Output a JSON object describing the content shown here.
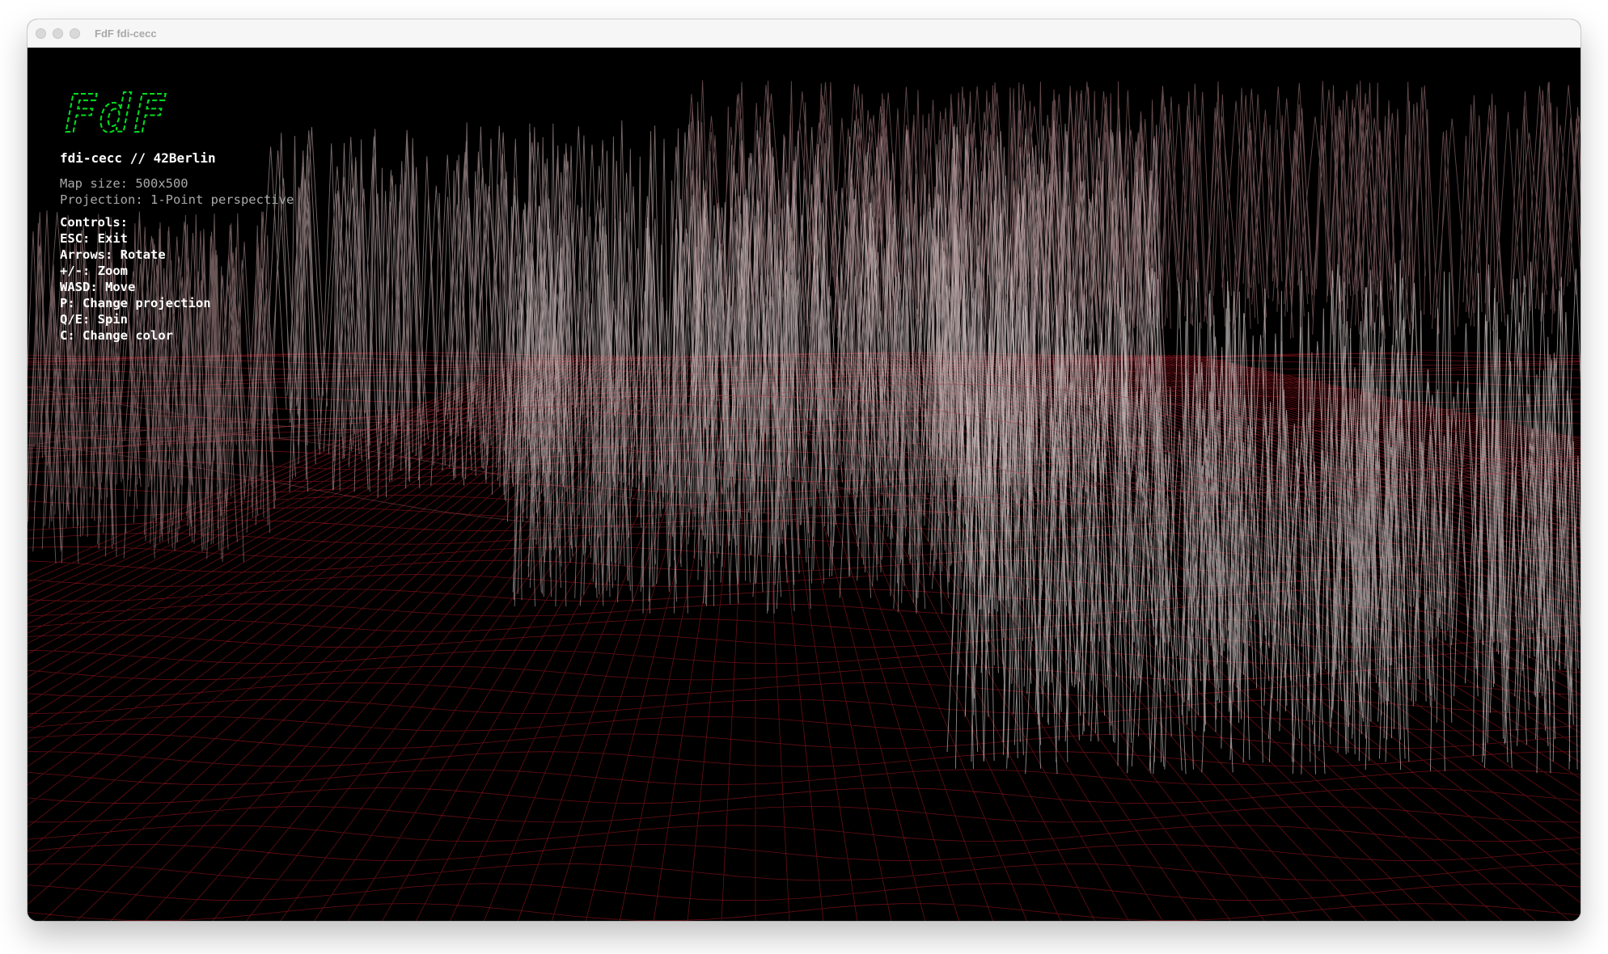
{
  "window": {
    "title": "FdF fdi-cecc"
  },
  "logo": {
    "text": "FdF",
    "color": "#00e020"
  },
  "hud": {
    "title": "fdi-cecc // 42Berlin",
    "map_size": "Map size: 500x500",
    "projection": "Projection: 1-Point perspective",
    "controls_header": "Controls:",
    "controls": [
      "ESC: Exit",
      "Arrows: Rotate",
      "+/-: Zoom",
      "WASD: Move",
      "P: Change projection",
      "Q/E: Spin",
      "C: Change color"
    ]
  },
  "colors": {
    "background": "#000000",
    "wire_low": "#7a1018",
    "wire_high": "#e8e8e8",
    "titlebar": "#f6f6f6"
  }
}
